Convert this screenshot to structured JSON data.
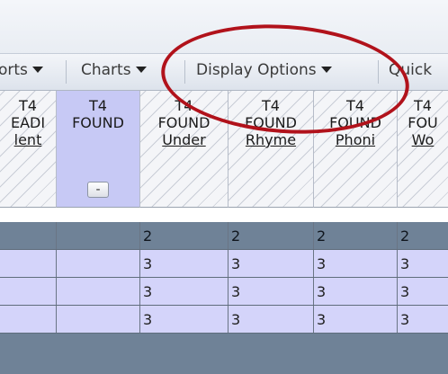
{
  "toolbar": {
    "reports_label": "orts",
    "charts_label": "Charts",
    "display_options_label": "Display Options",
    "quick_label": "Quick"
  },
  "columns": [
    {
      "line1": "T4",
      "line2": "EADI",
      "line3": "lent"
    },
    {
      "line1": "T4",
      "line2": "FOUND",
      "minus_label": "-"
    },
    {
      "line1": "T4",
      "line2": "FOUND",
      "line3": "Under"
    },
    {
      "line1": "T4",
      "line2": "FOUND",
      "line3": "Rhyme"
    },
    {
      "line1": "T4",
      "line2": "FOUND",
      "line3": "Phoni"
    },
    {
      "line1": "T4",
      "line2": "FOU",
      "line3": "Wo"
    }
  ],
  "rows": [
    [
      "",
      "",
      "2",
      "2",
      "2",
      "2"
    ],
    [
      "",
      "",
      "3",
      "3",
      "3",
      "3"
    ],
    [
      "",
      "",
      "3",
      "3",
      "3",
      "3"
    ],
    [
      "",
      "",
      "3",
      "3",
      "3",
      "3"
    ]
  ],
  "colors": {
    "annotation": "#b1121b",
    "selected_column": "#c7c9f5",
    "summary_row": "#6f8297",
    "data_row": "#d4d4fa"
  }
}
